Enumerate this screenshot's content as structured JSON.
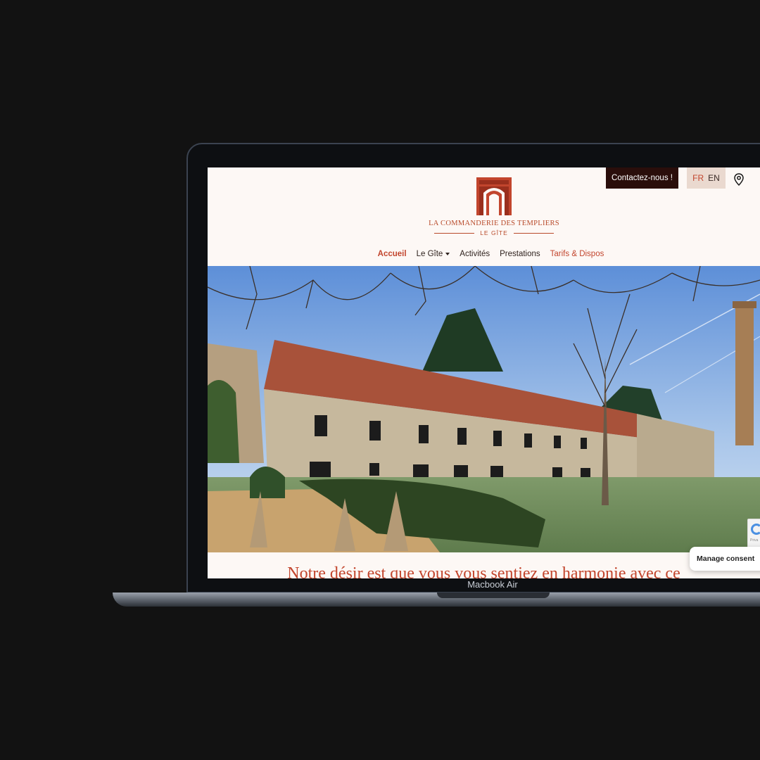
{
  "device": {
    "label": "Macbook Air"
  },
  "site": {
    "brand": {
      "name": "LA COMMANDERIE DES TEMPLIERS",
      "subtitle": "LE GÎTE",
      "logo_icon": "arch-logo-icon"
    },
    "topbar": {
      "contact_label": "Contactez-nous !",
      "lang_fr": "FR",
      "lang_en": "EN",
      "location_icon": "map-pin-icon"
    },
    "nav": [
      {
        "label": "Accueil",
        "active": true
      },
      {
        "label": "Le Gîte",
        "dropdown": true
      },
      {
        "label": "Activités"
      },
      {
        "label": "Prestations"
      },
      {
        "label": "Tarifs & Dispos"
      }
    ],
    "hero": {
      "image_description": "stone-farmhouse-photo"
    },
    "headline": "Notre désir est que vous vous sentiez en harmonie avec ce",
    "consent_label": "Manage consent",
    "recaptcha_text": "Priva"
  },
  "colors": {
    "accent": "#c2452d",
    "dark": "#2a0e0b",
    "background": "#fdf8f5",
    "lang_bg": "#ead9cf"
  }
}
